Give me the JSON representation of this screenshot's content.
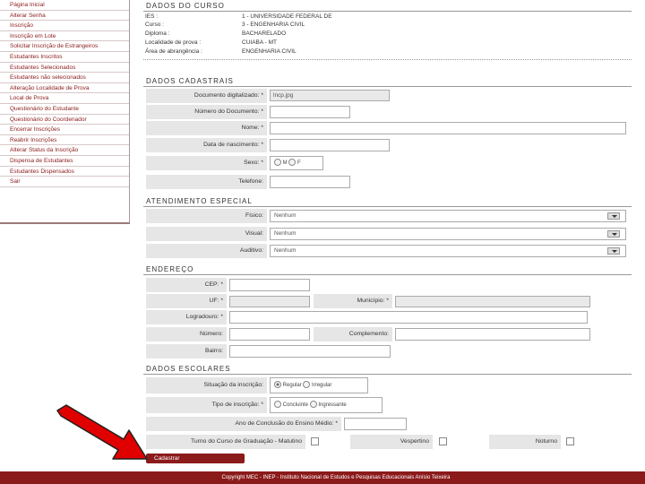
{
  "sidebar": {
    "items": [
      {
        "label": "Página Inicial"
      },
      {
        "label": "Alterar Senha"
      },
      {
        "label": "Inscrição"
      },
      {
        "label": "Inscrição em Lote"
      },
      {
        "label": "Solicitar Inscrição de Estrangeiros"
      },
      {
        "label": "Estudantes Inscritos"
      },
      {
        "label": "Estudantes Selecionados"
      },
      {
        "label": "Estudantes não selecionados"
      },
      {
        "label": "Alteração Localidade de Prova"
      },
      {
        "label": "Local de Prova"
      },
      {
        "label": "Questionário do Estudante"
      },
      {
        "label": "Questionário do Coordenador"
      },
      {
        "label": "Encerrar Inscrições"
      },
      {
        "label": "Reabrir Inscrições"
      },
      {
        "label": "Alterar Status da Inscrição"
      },
      {
        "label": "Dispensa de Estudantes"
      },
      {
        "label": "Estudantes Dispensados"
      },
      {
        "label": "Sair"
      }
    ]
  },
  "curso": {
    "title": "DADOS DO CURSO",
    "rows": [
      {
        "key": "IES :",
        "value": "1 - UNIVERSIDADE FEDERAL DE"
      },
      {
        "key": "Curso :",
        "value": "3 - ENGENHARIA CIVIL"
      },
      {
        "key": "Diploma :",
        "value": "BACHARELADO"
      },
      {
        "key": "Localidade de prova :",
        "value": "CUIABA - MT"
      },
      {
        "key": "Área de abrangência :",
        "value": "ENGENHARIA CIVIL"
      }
    ]
  },
  "cadastrais": {
    "title": "DADOS CADASTRAIS",
    "documento_label": "Documento digitalizado: *",
    "documento_value": "lncp.jpg",
    "numero_doc_label": "Número do Documento: *",
    "nome_label": "Nome: *",
    "nascimento_label": "Data de nascimento: *",
    "sexo_label": "Sexo: *",
    "sexo_m": "M",
    "sexo_f": "F",
    "telefone_label": "Telefone:"
  },
  "atendimento": {
    "title": "ATENDIMENTO ESPECIAL",
    "fisico_label": "Físico:",
    "fisico_value": "Nenhum",
    "visual_label": "Visual:",
    "visual_value": "Nenhum",
    "auditivo_label": "Auditivo:",
    "auditivo_value": "Nenhum"
  },
  "endereco": {
    "title": "ENDEREÇO",
    "cep_label": "CEP: *",
    "uf_label": "UF: *",
    "municipio_label": "Município: *",
    "logradouro_label": "Logradouro: *",
    "numero_label": "Número:",
    "complemento_label": "Complemento:",
    "bairro_label": "Bairro:"
  },
  "escolares": {
    "title": "DADOS ESCOLARES",
    "situacao_label": "Situação da inscrição:",
    "situacao_regular": "Regular",
    "situacao_irregular": "Irregular",
    "tipo_label": "Tipo de inscrição: *",
    "tipo_concluinte": "Concluinte",
    "tipo_ingressante": "Ingressante",
    "ano_label": "Ano de Conclusão do Ensino Médio: *",
    "turno_label": "Turno do Curso de Graduação - Matutino",
    "vespertino_label": "Vespertino",
    "noturno_label": "Noturno"
  },
  "actions": {
    "cadastrar_label": "Cadastrar"
  },
  "footer": {
    "text": "Copyright MEC - INEP - Instituto Nacional de Estudos e Pesquisas Educacionais Anísio Teixeira"
  },
  "colors": {
    "brand": "#8b1a1a",
    "annotation_arrow": "#e00000"
  }
}
